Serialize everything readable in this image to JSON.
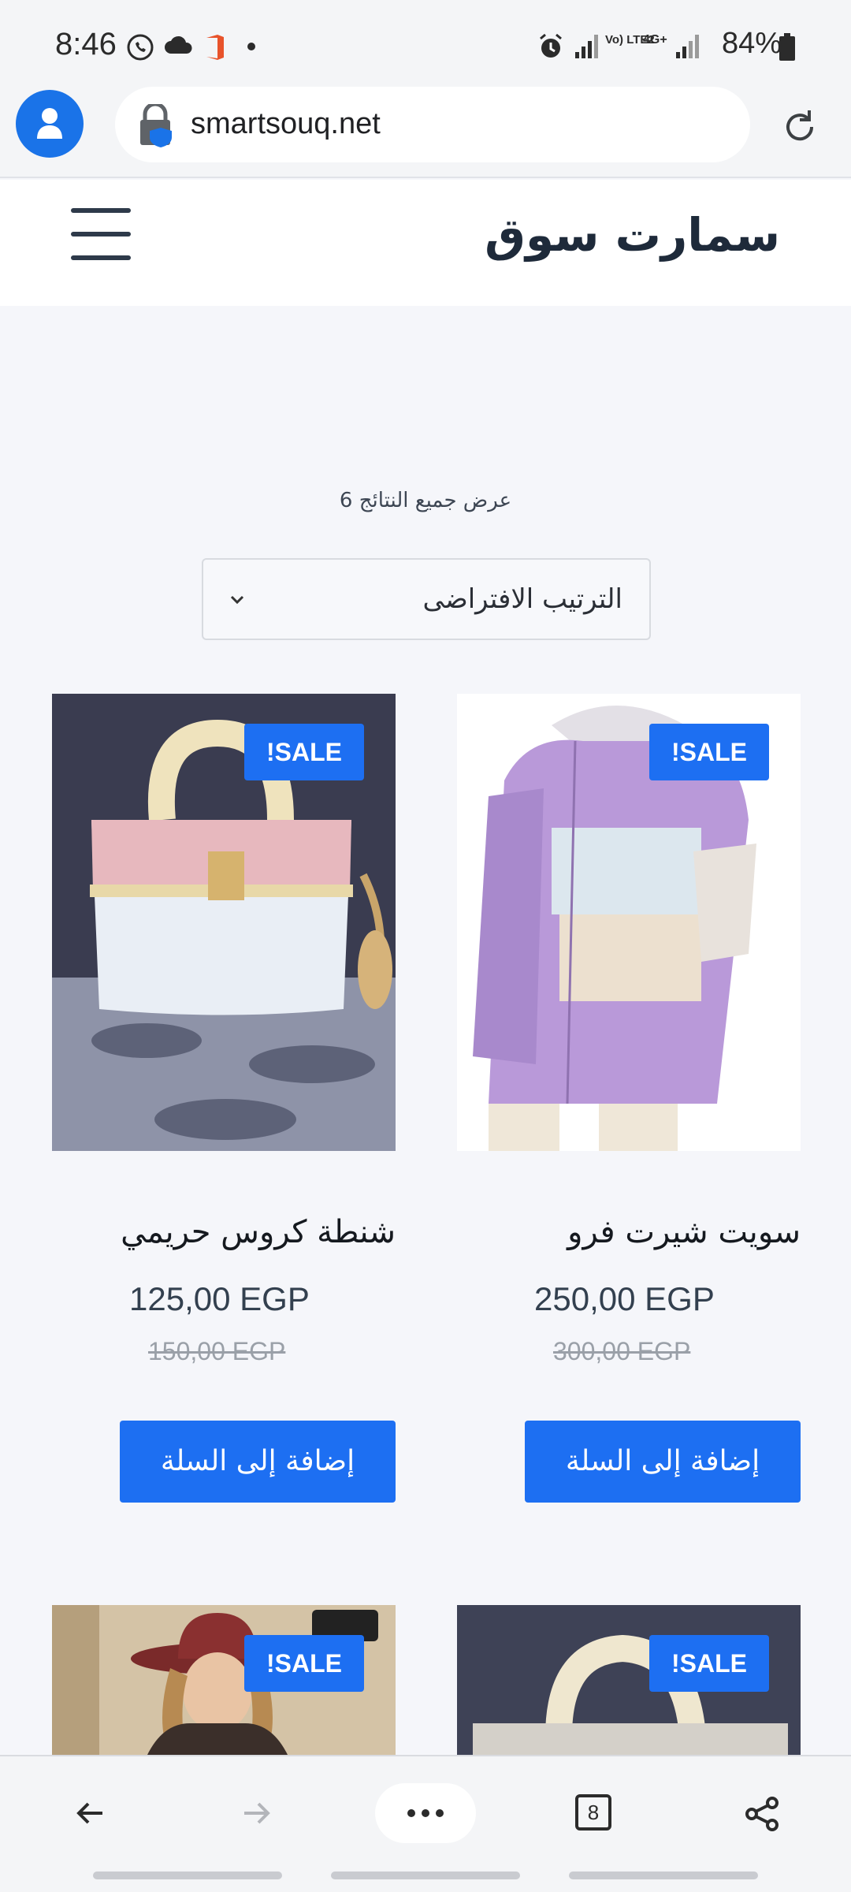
{
  "status_bar": {
    "time": "8:46",
    "battery": "84%",
    "network_labels": [
      "Vo) LTE2",
      "4G+"
    ]
  },
  "browser": {
    "url": "smartsouq.net",
    "tab_count": "8"
  },
  "site": {
    "title": "سمارت سوق"
  },
  "listing": {
    "results_text": "عرض جميع النتائج 6",
    "sort_selected": "الترتيب الافتراضى"
  },
  "products": [
    {
      "name": "سويت شيرت فرو",
      "price": "250,00 EGP",
      "old_price": "300,00 EGP",
      "badge": "!SALE",
      "button": "إضافة إلى السلة",
      "image": "purple-fur-hoodie"
    },
    {
      "name": "شنطة كروس حريمي",
      "price": "125,00 EGP",
      "old_price": "150,00 EGP",
      "badge": "!SALE",
      "button": "إضافة إلى السلة",
      "image": "pink-white-handbag"
    },
    {
      "badge": "!SALE",
      "image": "handbag-partial"
    },
    {
      "badge": "!SALE",
      "image": "woman-red-hat-partial"
    }
  ],
  "colors": {
    "accent": "#1d6ff2",
    "page_bg": "#f5f6fa",
    "header_bg": "#ffffff"
  }
}
